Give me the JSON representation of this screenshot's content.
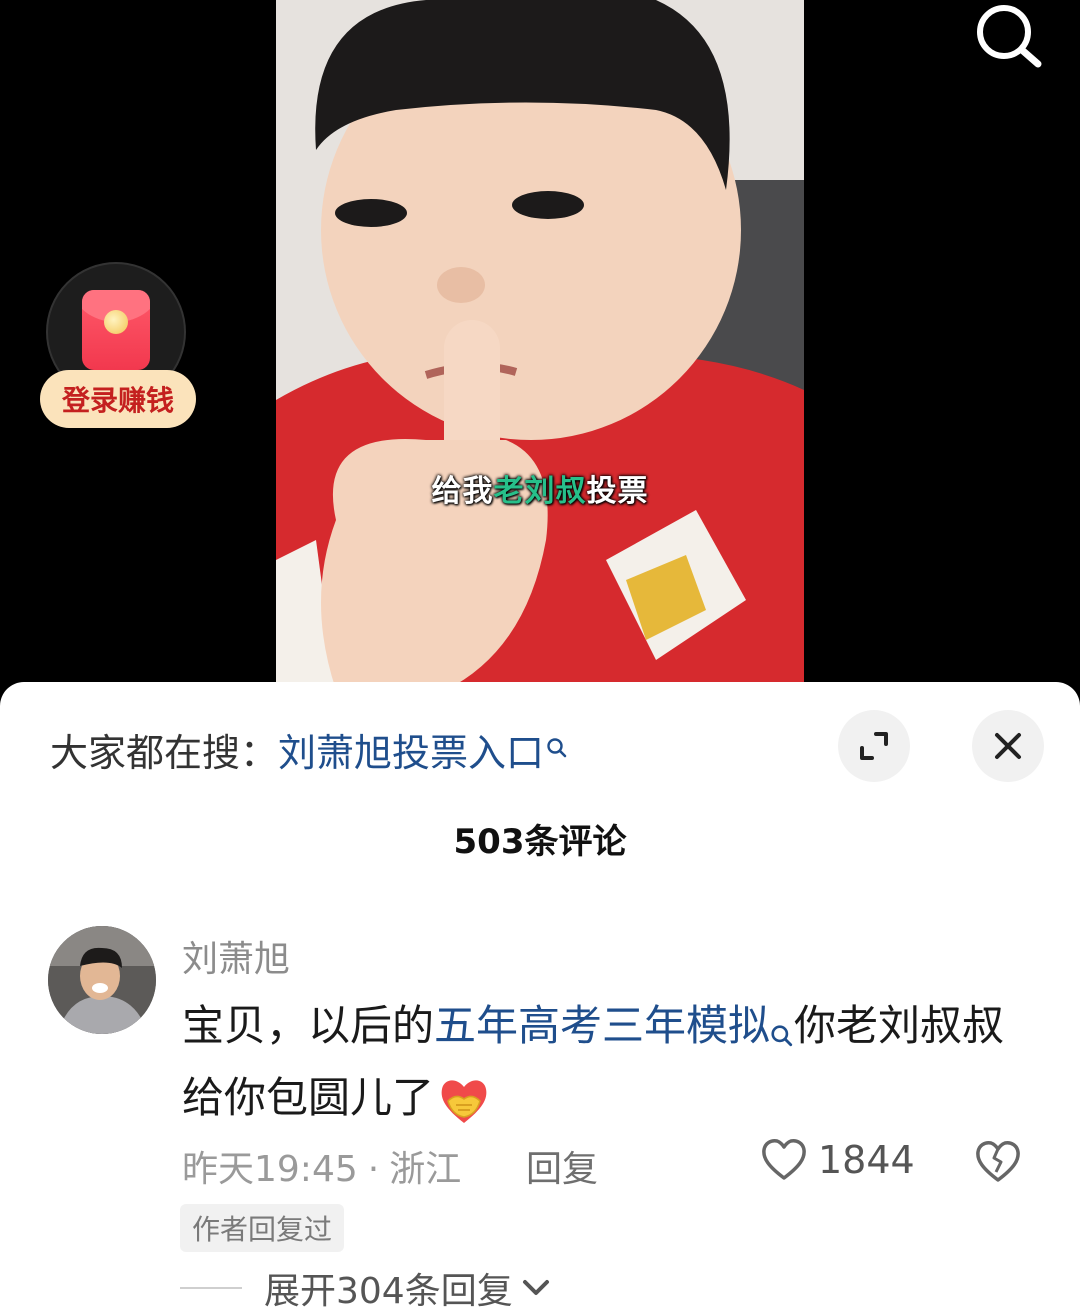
{
  "video": {
    "caption_part1": "给我",
    "caption_highlight": "老刘叔",
    "caption_part2": "投票"
  },
  "redpacket": {
    "label": "登录赚钱"
  },
  "hot_search": {
    "prefix": "大家都在搜：",
    "term": "刘萧旭投票入口"
  },
  "comments": {
    "count_label": "503条评论",
    "items": [
      {
        "username": "刘萧旭",
        "text_part1": "宝贝，以后的",
        "text_link": "五年高考三年模拟",
        "text_part2": "你老刘叔叔给你包圆儿了",
        "emoji": "handshake-heart-emoji",
        "time": "昨天19:45",
        "separator": "·",
        "location": "浙江",
        "reply_label": "回复",
        "likes": "1844",
        "author_badge": "作者回复过",
        "expand_label": "展开304条回复"
      }
    ]
  },
  "colors": {
    "link": "#1f4e8c",
    "caption_highlight": "#27c08a",
    "redpacket": "#f2384e"
  }
}
